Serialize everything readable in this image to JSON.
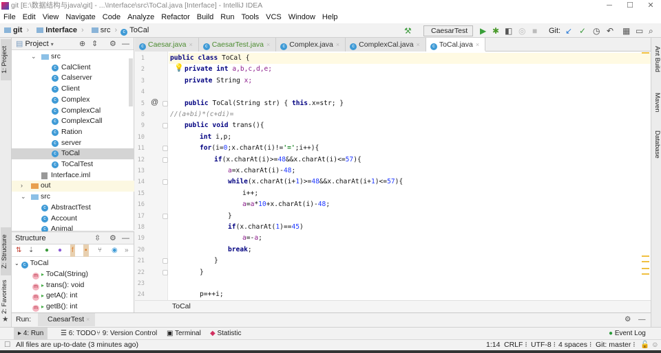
{
  "window": {
    "title": "git [E:\\数据结构与java\\git] - ...\\Interface\\src\\ToCal.java [Interface] - IntelliJ IDEA"
  },
  "menu": [
    "File",
    "Edit",
    "View",
    "Navigate",
    "Code",
    "Analyze",
    "Refactor",
    "Build",
    "Run",
    "Tools",
    "VCS",
    "Window",
    "Help"
  ],
  "breadcrumb": {
    "root": "git",
    "module": "Interface",
    "folder": "src",
    "file": "ToCal"
  },
  "toolbar": {
    "run_config": "CaesarTest",
    "git_label": "Git:"
  },
  "left_stripe": {
    "project": "1: Project",
    "structure": "Z: Structure",
    "favorites": "2: Favorites"
  },
  "project": {
    "title": "Project",
    "items": [
      {
        "label": "src",
        "kind": "folder",
        "indent": 2,
        "expanded": true
      },
      {
        "label": "CalClient",
        "kind": "class",
        "indent": 3
      },
      {
        "label": "Calserver",
        "kind": "class",
        "indent": 3
      },
      {
        "label": "Client",
        "kind": "class",
        "indent": 3
      },
      {
        "label": "Complex",
        "kind": "class",
        "indent": 3
      },
      {
        "label": "ComplexCal",
        "kind": "class",
        "indent": 3
      },
      {
        "label": "ComplexCall",
        "kind": "class",
        "indent": 3
      },
      {
        "label": "Ration",
        "kind": "class",
        "indent": 3
      },
      {
        "label": "server",
        "kind": "class",
        "indent": 3
      },
      {
        "label": "ToCal",
        "kind": "class",
        "indent": 3,
        "selected": true
      },
      {
        "label": "ToCalTest",
        "kind": "class",
        "indent": 3
      },
      {
        "label": "Interface.iml",
        "kind": "file",
        "indent": 2
      },
      {
        "label": "out",
        "kind": "folder-orange",
        "indent": 1,
        "expanded": false
      },
      {
        "label": "src",
        "kind": "folder",
        "indent": 1,
        "expanded": true
      },
      {
        "label": "AbstractTest",
        "kind": "class",
        "indent": 2
      },
      {
        "label": "Account",
        "kind": "class",
        "indent": 2
      },
      {
        "label": "Animal",
        "kind": "class",
        "indent": 2
      }
    ]
  },
  "structure": {
    "title": "Structure",
    "root": "ToCal",
    "members": [
      "ToCal(String)",
      "trans(): void",
      "getA(): int",
      "getB(): int"
    ]
  },
  "tabs": [
    {
      "label": "Caesar.java",
      "style": "green"
    },
    {
      "label": "CaesarTest.java",
      "style": "green"
    },
    {
      "label": "Complex.java",
      "style": "normal"
    },
    {
      "label": "ComplexCal.java",
      "style": "normal"
    },
    {
      "label": "ToCal.java",
      "style": "active"
    }
  ],
  "editor": {
    "lines": [
      {
        "n": "1",
        "indent": 0,
        "t": [
          [
            "public class ",
            "kw"
          ],
          [
            "ToCal",
            "plain"
          ],
          [
            " {",
            "plain"
          ]
        ]
      },
      {
        "n": "2",
        "indent": 1,
        "t": [
          [
            "private int ",
            "kw"
          ],
          [
            "a,b,c,d,e;",
            "fld"
          ]
        ]
      },
      {
        "n": "3",
        "indent": 1,
        "t": [
          [
            "private ",
            "kw"
          ],
          [
            "String ",
            "plain"
          ],
          [
            "x;",
            "fld"
          ]
        ]
      },
      {
        "n": "4",
        "indent": 0,
        "t": []
      },
      {
        "n": "5",
        "indent": 1,
        "t": [
          [
            "public ",
            "kw"
          ],
          [
            "ToCal(String str) { ",
            "plain"
          ],
          [
            "this",
            "kw"
          ],
          [
            ".x=str; }",
            "plain"
          ]
        ]
      },
      {
        "n": "8",
        "indent": 0,
        "t": [
          [
            "//(a+bi)*(c+di)=",
            "cmt"
          ]
        ]
      },
      {
        "n": "9",
        "indent": 1,
        "t": [
          [
            "public void ",
            "kw"
          ],
          [
            "trans(){",
            "plain"
          ]
        ]
      },
      {
        "n": "10",
        "indent": 2,
        "t": [
          [
            "int ",
            "kw"
          ],
          [
            "i,p;",
            "plain"
          ]
        ]
      },
      {
        "n": "11",
        "indent": 2,
        "t": [
          [
            "for",
            "kw"
          ],
          [
            "(i=",
            "plain"
          ],
          [
            "0",
            "num"
          ],
          [
            ";x.charAt(i)!=",
            "plain"
          ],
          [
            "'='",
            "str"
          ],
          [
            ";i++){",
            "plain"
          ]
        ]
      },
      {
        "n": "12",
        "indent": 3,
        "t": [
          [
            "if",
            "kw"
          ],
          [
            "(x.charAt(i)>=",
            "plain"
          ],
          [
            "48",
            "num"
          ],
          [
            "&&x.charAt(i)<=",
            "plain"
          ],
          [
            "57",
            "num"
          ],
          [
            "){",
            "plain"
          ]
        ]
      },
      {
        "n": "13",
        "indent": 4,
        "t": [
          [
            "a",
            "fld"
          ],
          [
            "=x.charAt(i)-",
            "plain"
          ],
          [
            "48",
            "num"
          ],
          [
            ";",
            "plain"
          ]
        ]
      },
      {
        "n": "14",
        "indent": 4,
        "t": [
          [
            "while",
            "kw"
          ],
          [
            "(x.charAt(i+",
            "plain"
          ],
          [
            "1",
            "num"
          ],
          [
            ")>=",
            "plain"
          ],
          [
            "48",
            "num"
          ],
          [
            "&&x.charAt(i+",
            "plain"
          ],
          [
            "1",
            "num"
          ],
          [
            ")<=",
            "plain"
          ],
          [
            "57",
            "num"
          ],
          [
            "){",
            "plain"
          ]
        ]
      },
      {
        "n": "15",
        "indent": 5,
        "t": [
          [
            "i++;",
            "plain"
          ]
        ]
      },
      {
        "n": "16",
        "indent": 5,
        "t": [
          [
            "a",
            "fld"
          ],
          [
            "=",
            "plain"
          ],
          [
            "a",
            "fld"
          ],
          [
            "*",
            "plain"
          ],
          [
            "10",
            "num"
          ],
          [
            "+x.charAt(i)-",
            "plain"
          ],
          [
            "48",
            "num"
          ],
          [
            ";",
            "plain"
          ]
        ]
      },
      {
        "n": "17",
        "indent": 4,
        "t": [
          [
            "}",
            "plain"
          ]
        ]
      },
      {
        "n": "18",
        "indent": 4,
        "t": [
          [
            "if",
            "kw"
          ],
          [
            "(x.charAt(",
            "plain"
          ],
          [
            "1",
            "num"
          ],
          [
            ")==",
            "plain"
          ],
          [
            "45",
            "num"
          ],
          [
            ")",
            "plain"
          ]
        ]
      },
      {
        "n": "19",
        "indent": 5,
        "t": [
          [
            "a",
            "fld"
          ],
          [
            "=-",
            "plain"
          ],
          [
            "a",
            "fld"
          ],
          [
            ";",
            "plain"
          ]
        ]
      },
      {
        "n": "20",
        "indent": 4,
        "t": [
          [
            "break",
            "kw"
          ],
          [
            ";",
            "plain"
          ]
        ]
      },
      {
        "n": "21",
        "indent": 3,
        "t": [
          [
            "}",
            "plain"
          ]
        ]
      },
      {
        "n": "22",
        "indent": 2,
        "t": [
          [
            "}",
            "plain"
          ]
        ]
      },
      {
        "n": "23",
        "indent": 0,
        "t": []
      },
      {
        "n": "24",
        "indent": 2,
        "t": [
          [
            "p=++i;",
            "plain"
          ]
        ]
      }
    ],
    "breadcrumb": "ToCal"
  },
  "right_stripe": {
    "ant": "Ant Build",
    "maven": "Maven",
    "database": "Database"
  },
  "run_panel": {
    "label": "Run:",
    "config": "CaesarTest"
  },
  "bottom_tabs": [
    "4: Run",
    "6: TODO",
    "9: Version Control",
    "Terminal",
    "Statistic"
  ],
  "event_log": "Event Log",
  "status": {
    "message": "All files are up-to-date (3 minutes ago)",
    "position": "1:14",
    "line_sep": "CRLF",
    "encoding": "UTF-8",
    "indent": "4 spaces",
    "vcs": "Git: master"
  }
}
